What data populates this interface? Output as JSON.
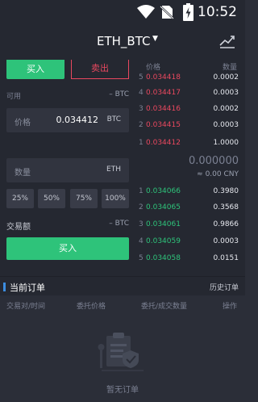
{
  "status_bar": {
    "time": "10:52"
  },
  "header": {
    "pair": "ETH_BTC"
  },
  "trade": {
    "buy_tab": "买入",
    "sell_tab": "卖出",
    "available_label": "可用",
    "available_value": "– BTC",
    "price_label": "价格",
    "price_value": "0.034412",
    "price_unit": "BTC",
    "qty_label": "数量",
    "qty_unit": "ETH",
    "percents": [
      "25%",
      "50%",
      "75%",
      "100%"
    ],
    "amount_label": "交易额",
    "amount_value": "– BTC",
    "buy_button": "买入"
  },
  "orderbook": {
    "price_header": "价格",
    "qty_header": "数量",
    "asks": [
      {
        "idx": "5",
        "price": "0.034418",
        "qty": "0.0002"
      },
      {
        "idx": "4",
        "price": "0.034417",
        "qty": "0.0003"
      },
      {
        "idx": "3",
        "price": "0.034416",
        "qty": "0.0002"
      },
      {
        "idx": "2",
        "price": "0.034415",
        "qty": "0.0003"
      },
      {
        "idx": "1",
        "price": "0.034412",
        "qty": "1.0000"
      }
    ],
    "last_price": "0.000000",
    "last_cny": "≈ 0.00 CNY",
    "bids": [
      {
        "idx": "1",
        "price": "0.034066",
        "qty": "0.3980"
      },
      {
        "idx": "2",
        "price": "0.034065",
        "qty": "0.3568"
      },
      {
        "idx": "3",
        "price": "0.034061",
        "qty": "0.9866"
      },
      {
        "idx": "4",
        "price": "0.034059",
        "qty": "0.0003"
      },
      {
        "idx": "5",
        "price": "0.034058",
        "qty": "0.0151"
      }
    ]
  },
  "orders": {
    "title": "当前订单",
    "history": "历史订单",
    "columns": [
      "交易对/时间",
      "委托价格",
      "委托/成交数量",
      "操作"
    ],
    "empty": "暂无订单"
  },
  "colors": {
    "buy": "#2ec37a",
    "sell": "#e9485f",
    "accent": "#3c8de0"
  }
}
